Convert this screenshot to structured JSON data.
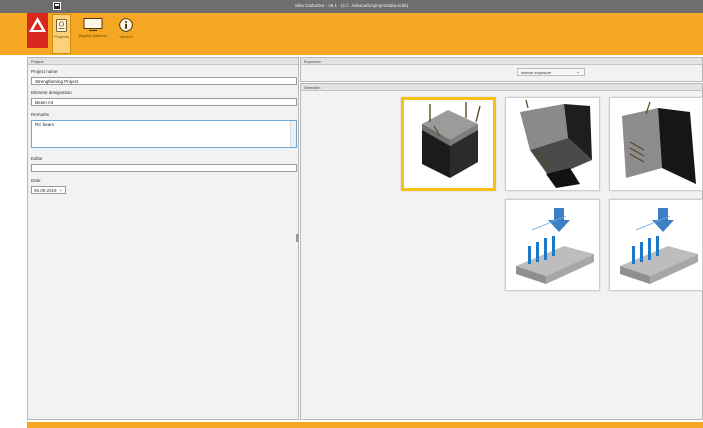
{
  "window": {
    "title": "Sika CarboDur - v5.1 - (C:\\...\\sikacarbo\\projectdata.scbk)"
  },
  "ribbon": {
    "buttons": [
      {
        "label": "Projects",
        "icon": "project-file-icon",
        "active": true
      },
      {
        "label": "Display platform",
        "icon": "monitor-icon",
        "active": false
      },
      {
        "label": "Version",
        "icon": "info-icon",
        "active": false
      }
    ]
  },
  "project_pane": {
    "header": "Project",
    "project_name_label": "Project name",
    "project_name_value": "Strengthening Project",
    "element_label": "Element designation",
    "element_value": "Beam A3",
    "remarks_label": "Remarks",
    "remarks_value": "RC beam",
    "editor_label": "Editor",
    "editor_value": "",
    "date_label": "Date",
    "date_value": "06.09.2019"
  },
  "exposure_pane": {
    "header": "Exposure",
    "selected": "Interior exposure"
  },
  "selection_pane": {
    "header": "Selection",
    "tiles": [
      {
        "name": "column-top-tile",
        "selected": true
      },
      {
        "name": "beam-bottom-strips-tile",
        "selected": false
      },
      {
        "name": "beam-side-tile",
        "selected": false
      },
      {
        "name": "slab-diagram-tile-1",
        "selected": false
      },
      {
        "name": "slab-diagram-tile-2",
        "selected": false
      }
    ]
  },
  "colors": {
    "accent": "#f5a623",
    "brand_red": "#d8261c",
    "titlebar": "#6e6e6e",
    "selected_tile": "#f5c21b"
  }
}
